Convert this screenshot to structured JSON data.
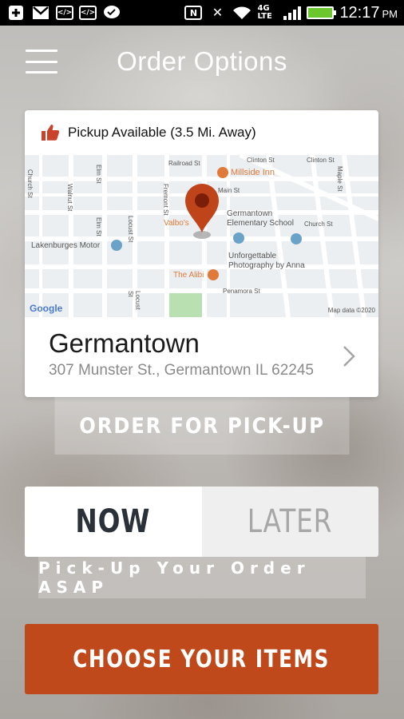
{
  "status_bar": {
    "network": "4G LTE",
    "time": "12:17",
    "ampm": "PM"
  },
  "header": {
    "title": "Order Options",
    "menu_icon": "hamburger-menu-icon"
  },
  "location_card": {
    "pickup_status": "Pickup Available (3.5 Mi. Away)",
    "status_icon": "thumbs-up-icon",
    "location_name": "Germantown",
    "address": "307 Munster St., Germantown IL 62245",
    "map": {
      "street_labels": [
        "Clinton St",
        "Clinton St",
        "Railroad St",
        "Main St",
        "Church St",
        "Elm St",
        "Elm St",
        "Locust St",
        "Locust St",
        "Walnut St",
        "Church St",
        "Fremont St",
        "Maple St",
        "Penamora St"
      ],
      "places": [
        "Millside Inn",
        "Germantown Elementary School",
        "Lakenburges Motor",
        "Unforgettable Photography by Anna",
        "The Alibi",
        "Valbo's"
      ],
      "brand": "Google",
      "attribution": "Map data ©2020",
      "accent_color": "#e07a3a",
      "marker_color": "#c0441a"
    }
  },
  "order_type_button": "ORDER FOR PICK-UP",
  "timing": {
    "now_label": "NOW",
    "later_label": "LATER",
    "selected": "NOW",
    "description": "Pick-Up Your Order ASAP"
  },
  "cta_label": "CHOOSE YOUR ITEMS",
  "colors": {
    "cta": "#c0491b",
    "status_battery": "#6bc72c"
  }
}
